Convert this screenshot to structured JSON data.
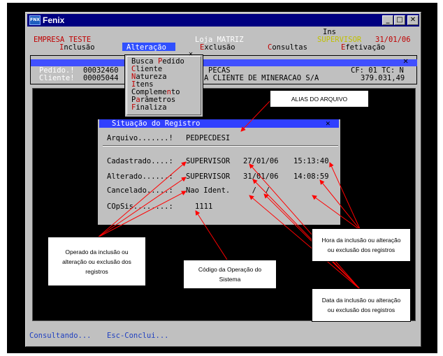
{
  "window": {
    "title": "Fenix",
    "app_icon_text": "FNX",
    "buttons": {
      "minimize": "_",
      "maximize": "□",
      "close": "✕"
    }
  },
  "header": {
    "mode": "Ins",
    "company": "EMPRESA TESTE",
    "store": "Loja MATRIZ",
    "user": "SUPERVISOR",
    "date": "31/01/06"
  },
  "menubar": {
    "inclusao": {
      "hot": "I",
      "rest": "nclusão"
    },
    "alteracao": {
      "label": "Alteração"
    },
    "exclusao": {
      "hot": "E",
      "rest": "xclusão"
    },
    "consultas": {
      "hot": "C",
      "rest": "onsultas"
    },
    "efetivacao": {
      "hot": "E",
      "rest": "fetivação"
    }
  },
  "record": {
    "pedido_label": "Pedido.!",
    "pedido_value": "00032460",
    "cliente_label": "Cliente!",
    "cliente_value": "00005044",
    "pecas": "PECAS",
    "cliente_name": "A CLIENTE DE MINERACAO S/A",
    "cf_tc": "CF: 01 TC: N",
    "amount": "379.031,49",
    "close": "✕"
  },
  "dropdown": {
    "close": "✕",
    "items": [
      {
        "pre": "Busca ",
        "hot": "P",
        "post": "edido"
      },
      {
        "pre": "",
        "hot": "C",
        "post": "liente"
      },
      {
        "pre": "",
        "hot": "N",
        "post": "atureza"
      },
      {
        "pre": "",
        "hot": "I",
        "post": "tens"
      },
      {
        "pre": "Compleme",
        "hot": "n",
        "post": "to"
      },
      {
        "pre": "P",
        "hot": "a",
        "post": "râmetros"
      },
      {
        "pre": "",
        "hot": "F",
        "post": "inaliza"
      }
    ]
  },
  "dialog": {
    "title": "Situação do Registro",
    "close": "✕",
    "arquivo_label": "Arquivo.......!",
    "arquivo_value": "PEDPECDESI",
    "cadastrado_label": "Cadastrado....:",
    "cadastrado_user": "SUPERVISOR",
    "cadastrado_date": "27/01/06",
    "cadastrado_time": "15:13:40",
    "alterado_label": "Alterado......:",
    "alterado_user": "SUPERVISOR",
    "alterado_date": "31/01/06",
    "alterado_time": "14:08:59",
    "cancelado_label": "Cancelado.....:",
    "cancelado_user": "Nao Ident.",
    "cancelado_date": "  /  /",
    "copsis_label": "COpSis........:",
    "copsis_value": "1111"
  },
  "status": {
    "consultando": "Consultando...",
    "esc": "Esc-Conclui..."
  },
  "callouts": {
    "alias": "ALIAS DO ARQUIVO",
    "operador": "Operado da inclusão ou alteração ou exclusão dos registros",
    "codigo": "Código da Operação do Sistema",
    "hora": "Hora da inclusão ou alteração ou exclusão dos registros",
    "data": "Data da inclusão ou alteração ou exclusão dos registros"
  },
  "colors": {
    "title_bar": "#000080",
    "highlight_band": "#3050ff",
    "hotkey_red": "#c00000",
    "annotation_arrow": "#ff0000"
  }
}
